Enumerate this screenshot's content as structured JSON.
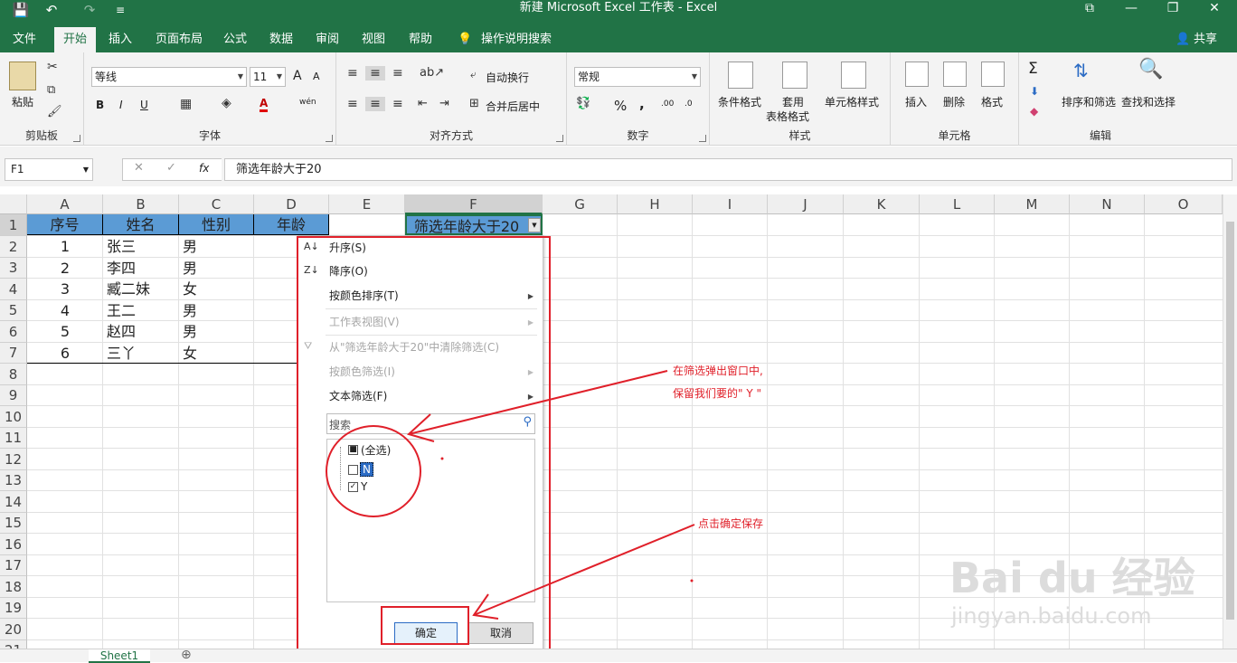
{
  "window": {
    "title": "新建 Microsoft Excel 工作表  -  Excel",
    "restore_glyph": "⧉",
    "minimize_glyph": "—",
    "maximize_glyph": "❐",
    "close_glyph": "✕"
  },
  "quick_access": {
    "save_icon": "💾",
    "undo_icon": "↶",
    "redo_icon": "↷",
    "customize_icon": "≡"
  },
  "tabs": [
    "文件",
    "开始",
    "插入",
    "页面布局",
    "公式",
    "数据",
    "审阅",
    "视图",
    "帮助"
  ],
  "tell_me": "操作说明搜索",
  "share": "共享",
  "ribbon": {
    "clipboard": {
      "paste": "粘贴",
      "label": "剪贴板"
    },
    "font": {
      "name": "等线",
      "size": "11",
      "label": "字体",
      "grow": "A",
      "shrink": "A",
      "bold": "B",
      "italic": "I",
      "underline": "U",
      "wen": "wén",
      "font_color": "A"
    },
    "alignment": {
      "wrap": "自动换行",
      "merge": "合并后居中",
      "label": "对齐方式"
    },
    "number": {
      "format": "常规",
      "label": "数字",
      "percent": "%",
      "comma": ",",
      "inc": ".00",
      "dec": ".0"
    },
    "styles": {
      "conditional": "条件格式",
      "table_1": "套用",
      "table_2": "表格格式",
      "cell_styles": "单元格样式",
      "label": "样式"
    },
    "cells": {
      "insert": "插入",
      "delete": "删除",
      "format": "格式",
      "label": "单元格"
    },
    "editing": {
      "sort_filter": "排序和筛选",
      "find_select": "查找和选择",
      "label": "编辑",
      "sigma": "Σ"
    }
  },
  "formula_bar": {
    "name_box": "F1",
    "content": "筛选年龄大于20",
    "cancel": "✕",
    "enter": "✓",
    "fx": "fx"
  },
  "columns": [
    "A",
    "B",
    "C",
    "D",
    "E",
    "F",
    "G",
    "H",
    "I",
    "J",
    "K",
    "L",
    "M",
    "N",
    "O"
  ],
  "rows": [
    "1",
    "2",
    "3",
    "4",
    "5",
    "6",
    "7",
    "8",
    "9",
    "10",
    "11",
    "12",
    "13",
    "14",
    "15",
    "16",
    "17",
    "18",
    "19",
    "20",
    "21"
  ],
  "headers": {
    "a": "序号",
    "b": "姓名",
    "c": "性别",
    "d": "年龄",
    "f": "筛选年龄大于20"
  },
  "table": [
    {
      "no": "1",
      "name": "张三",
      "sex": "男"
    },
    {
      "no": "2",
      "name": "李四",
      "sex": "男"
    },
    {
      "no": "3",
      "name": "臧二妹",
      "sex": "女"
    },
    {
      "no": "4",
      "name": "王二",
      "sex": "男"
    },
    {
      "no": "5",
      "name": "赵四",
      "sex": "男"
    },
    {
      "no": "6",
      "name": "三丫",
      "sex": "女"
    }
  ],
  "filter_menu": {
    "sort_asc": "升序(S)",
    "sort_desc": "降序(O)",
    "sort_color": "按颜色排序(T)",
    "sheet_view": "工作表视图(V)",
    "clear": "从\"筛选年龄大于20\"中清除筛选(C)",
    "filter_color": "按颜色筛选(I)",
    "text_filter": "文本筛选(F)",
    "search_placeholder": "搜索",
    "items": [
      {
        "label": "(全选)",
        "state": "■"
      },
      {
        "label": "N",
        "state": ""
      },
      {
        "label": "Y",
        "state": "✓"
      }
    ],
    "ok": "确定",
    "cancel": "取消"
  },
  "annotations": {
    "note1_line1": "在筛选弹出窗口中,",
    "note1_line2": "保留我们要的\" Y \"",
    "note2": "点击确定保存"
  },
  "watermark": {
    "brand": "Bai du 经验",
    "url": "jingyan.baidu.com"
  },
  "sheet_tab": "Sheet1",
  "add_sheet": "⊕",
  "colors": {
    "excel_green": "#217346",
    "header_fill": "#5b9bd5",
    "annotation_red": "#e0202a"
  }
}
